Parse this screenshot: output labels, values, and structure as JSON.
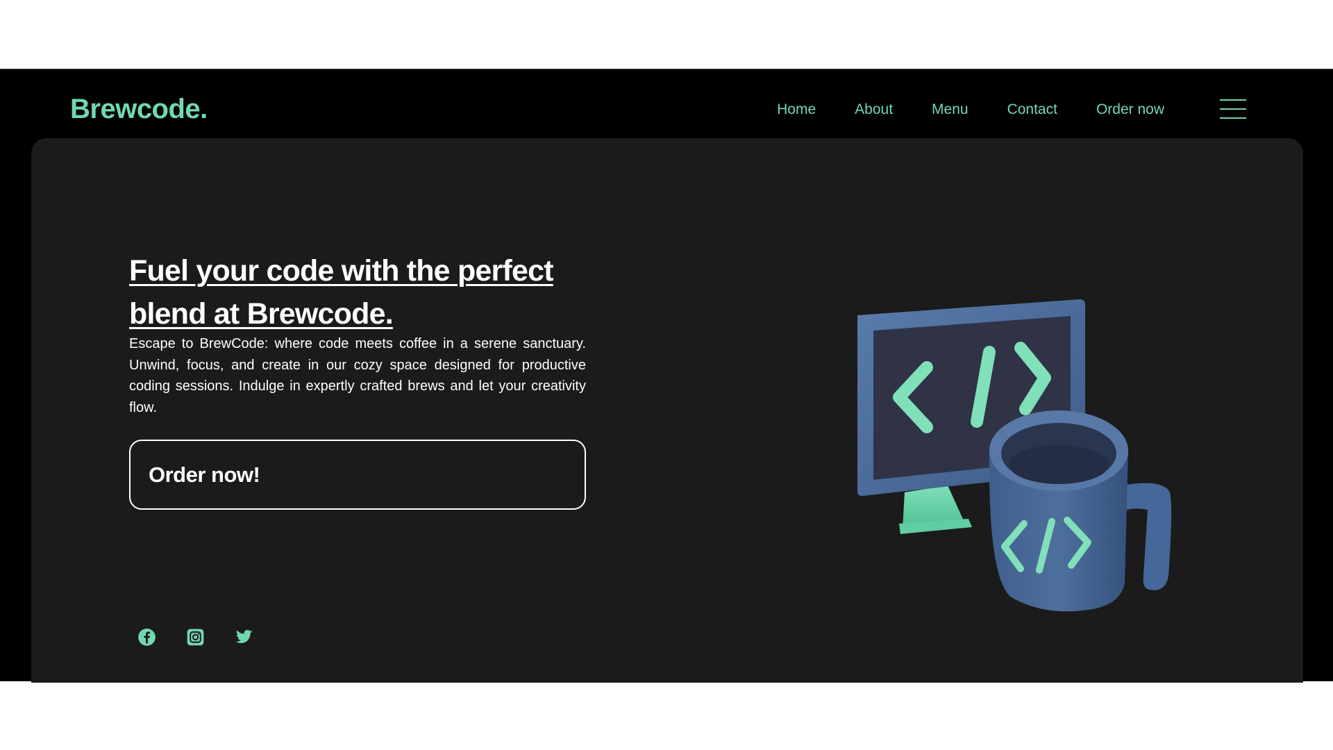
{
  "brand": {
    "logo": "Brewcode.",
    "accent": "#72d8b0"
  },
  "nav": {
    "items": [
      {
        "label": "Home"
      },
      {
        "label": "About"
      },
      {
        "label": "Menu"
      },
      {
        "label": "Contact"
      },
      {
        "label": "Order now"
      }
    ],
    "menu_icon": "hamburger-menu-icon"
  },
  "hero": {
    "headline": "Fuel your code with the perfect blend at Brewcode.",
    "description": "Escape to BrewCode: where code meets coffee in a serene sanctuary. Unwind, focus, and create in our cozy space designed for productive coding sessions. Indulge in expertly crafted brews and let your creativity flow.",
    "cta_label": "Order now!",
    "illustration": "monitor-and-coffee-mug-illustration"
  },
  "social": {
    "icons": [
      "facebook-icon",
      "instagram-icon",
      "twitter-icon"
    ]
  },
  "colors": {
    "page_background": "#000000",
    "hero_background": "#1b1b1b",
    "text": "#ffffff"
  }
}
